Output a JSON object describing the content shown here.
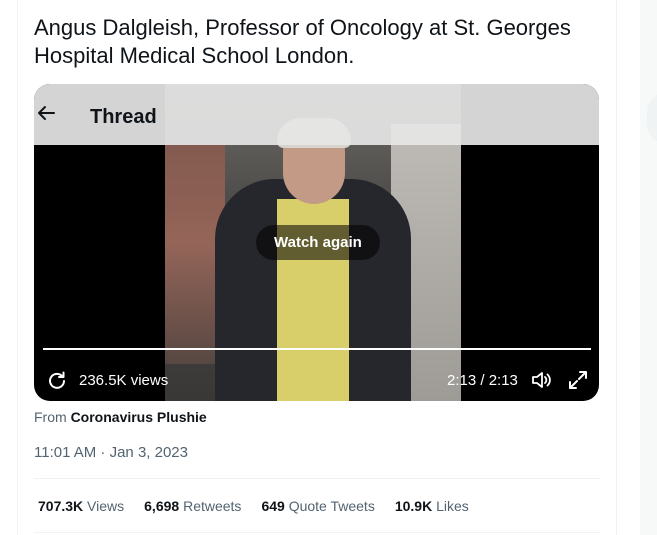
{
  "tweet": {
    "text": "Angus Dalgleish, Professor of Oncology at St. Georges Hospital Medical School London."
  },
  "video": {
    "header_title": "Thread",
    "watch_again_label": "Watch again",
    "views_label": "236.5K views",
    "time_label": "2:13 / 2:13",
    "progress": 1.0
  },
  "source": {
    "prefix": "From",
    "account": "Coronavirus Plushie"
  },
  "timestamp": "11:01 AM · Jan 3, 2023",
  "stats": [
    {
      "value": "707.3K",
      "label": "Views"
    },
    {
      "value": "6,698",
      "label": "Retweets"
    },
    {
      "value": "649",
      "label": "Quote Tweets"
    },
    {
      "value": "10.9K",
      "label": "Likes"
    }
  ],
  "icons": {
    "back": "arrow-left-icon",
    "replay": "replay-icon",
    "volume": "volume-icon",
    "fullscreen": "fullscreen-icon"
  },
  "colors": {
    "text_primary": "#0f1419",
    "text_secondary": "#536471",
    "border": "#eff3f4"
  }
}
